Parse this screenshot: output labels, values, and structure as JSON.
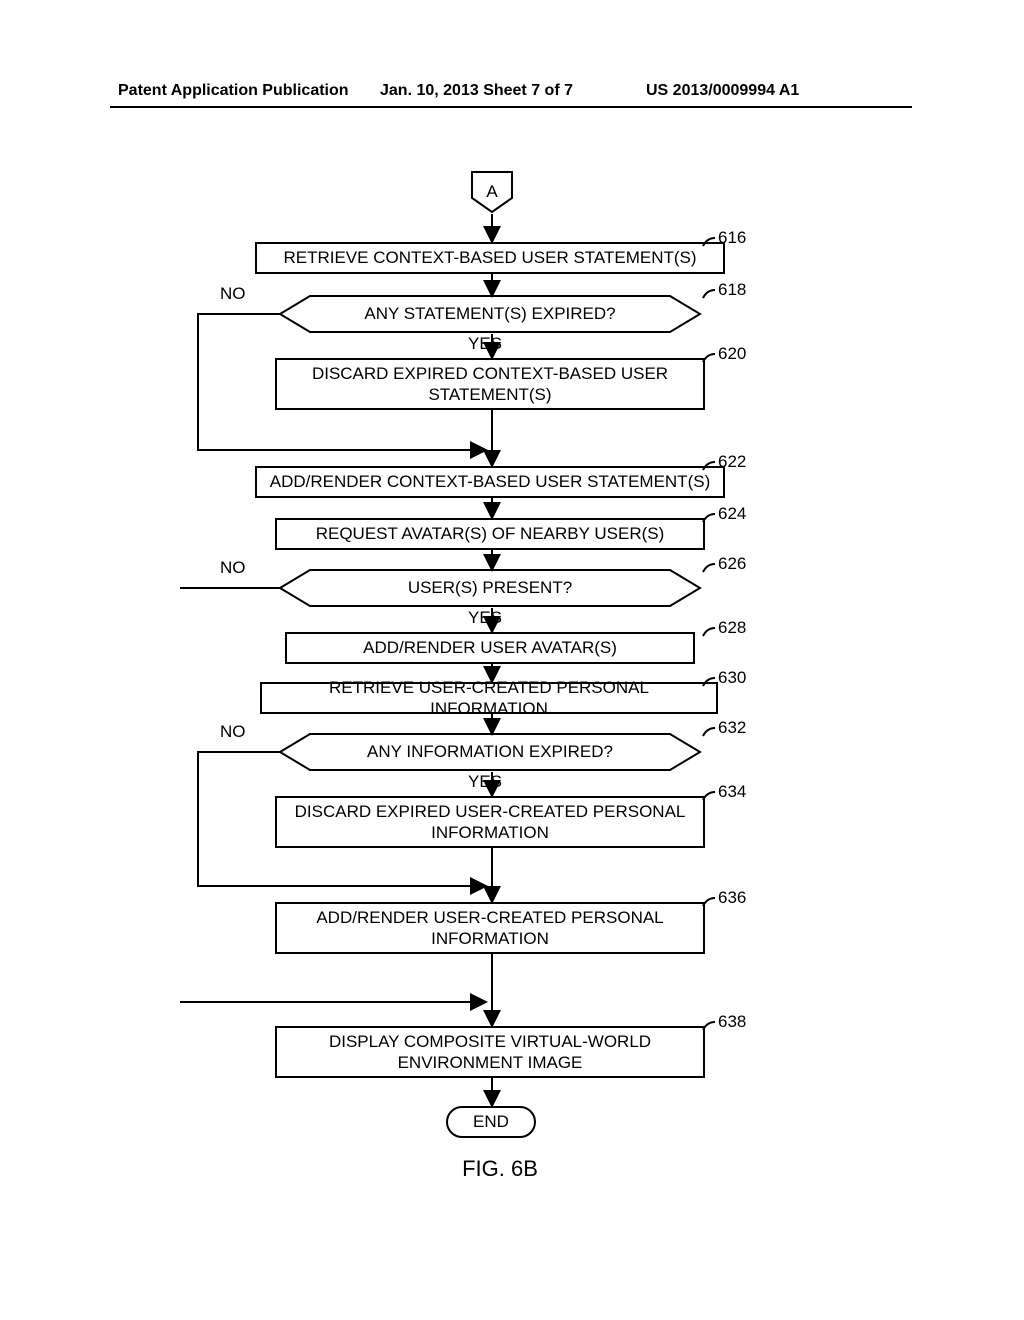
{
  "header": {
    "left": "Patent Application Publication",
    "center": "Jan. 10, 2013  Sheet 7 of 7",
    "right": "US 2013/0009994 A1"
  },
  "chart_data": {
    "type": "flowchart",
    "title": "FIG. 6B",
    "nodes": [
      {
        "id": "A",
        "type": "offpage",
        "label": "A"
      },
      {
        "id": "616",
        "type": "process",
        "label": "RETRIEVE CONTEXT-BASED USER STATEMENT(S)",
        "ref": "616"
      },
      {
        "id": "618",
        "type": "decision",
        "label": "ANY STATEMENT(S) EXPIRED?",
        "ref": "618"
      },
      {
        "id": "620",
        "type": "process",
        "label": "DISCARD EXPIRED CONTEXT-BASED USER STATEMENT(S)",
        "ref": "620"
      },
      {
        "id": "622",
        "type": "process",
        "label": "ADD/RENDER CONTEXT-BASED USER STATEMENT(S)",
        "ref": "622"
      },
      {
        "id": "624",
        "type": "process",
        "label": "REQUEST AVATAR(S) OF NEARBY USER(S)",
        "ref": "624"
      },
      {
        "id": "626",
        "type": "decision",
        "label": "USER(S) PRESENT?",
        "ref": "626"
      },
      {
        "id": "628",
        "type": "process",
        "label": "ADD/RENDER USER AVATAR(S)",
        "ref": "628"
      },
      {
        "id": "630",
        "type": "process",
        "label": "RETRIEVE USER-CREATED PERSONAL INFORMATION",
        "ref": "630"
      },
      {
        "id": "632",
        "type": "decision",
        "label": "ANY INFORMATION EXPIRED?",
        "ref": "632"
      },
      {
        "id": "634",
        "type": "process",
        "label": "DISCARD EXPIRED USER-CREATED PERSONAL INFORMATION",
        "ref": "634"
      },
      {
        "id": "636",
        "type": "process",
        "label": "ADD/RENDER USER-CREATED PERSONAL INFORMATION",
        "ref": "636"
      },
      {
        "id": "638",
        "type": "process",
        "label": "DISPLAY COMPOSITE VIRTUAL-WORLD ENVIRONMENT IMAGE",
        "ref": "638"
      },
      {
        "id": "END",
        "type": "terminator",
        "label": "END"
      }
    ],
    "edges": [
      {
        "from": "A",
        "to": "616"
      },
      {
        "from": "616",
        "to": "618"
      },
      {
        "from": "618",
        "to": "620",
        "label": "YES"
      },
      {
        "from": "618",
        "to": "622",
        "label": "NO",
        "via": "left"
      },
      {
        "from": "620",
        "to": "622"
      },
      {
        "from": "622",
        "to": "624"
      },
      {
        "from": "624",
        "to": "626"
      },
      {
        "from": "626",
        "to": "628",
        "label": "YES"
      },
      {
        "from": "626",
        "to": "638",
        "label": "NO",
        "via": "left"
      },
      {
        "from": "628",
        "to": "630"
      },
      {
        "from": "630",
        "to": "632"
      },
      {
        "from": "632",
        "to": "634",
        "label": "YES"
      },
      {
        "from": "632",
        "to": "636",
        "label": "NO",
        "via": "left"
      },
      {
        "from": "634",
        "to": "636"
      },
      {
        "from": "636",
        "to": "638"
      },
      {
        "from": "638",
        "to": "END"
      }
    ]
  },
  "labels": {
    "yes": "YES",
    "no": "NO",
    "end": "END",
    "a": "A",
    "fig": "FIG. 6B",
    "ref616": "616",
    "ref618": "618",
    "ref620": "620",
    "ref622": "622",
    "ref624": "624",
    "ref626": "626",
    "ref628": "628",
    "ref630": "630",
    "ref632": "632",
    "ref634": "634",
    "ref636": "636",
    "ref638": "638"
  },
  "steps": {
    "s616": "RETRIEVE CONTEXT-BASED USER STATEMENT(S)",
    "s618": "ANY STATEMENT(S) EXPIRED?",
    "s620": "DISCARD EXPIRED CONTEXT-BASED USER STATEMENT(S)",
    "s622": "ADD/RENDER CONTEXT-BASED USER STATEMENT(S)",
    "s624": "REQUEST AVATAR(S) OF NEARBY USER(S)",
    "s626": "USER(S) PRESENT?",
    "s628": "ADD/RENDER USER AVATAR(S)",
    "s630": "RETRIEVE USER-CREATED PERSONAL INFORMATION",
    "s632": "ANY INFORMATION EXPIRED?",
    "s634": "DISCARD EXPIRED USER-CREATED PERSONAL INFORMATION",
    "s636": "ADD/RENDER USER-CREATED PERSONAL INFORMATION",
    "s638": "DISPLAY COMPOSITE VIRTUAL-WORLD ENVIRONMENT IMAGE"
  }
}
